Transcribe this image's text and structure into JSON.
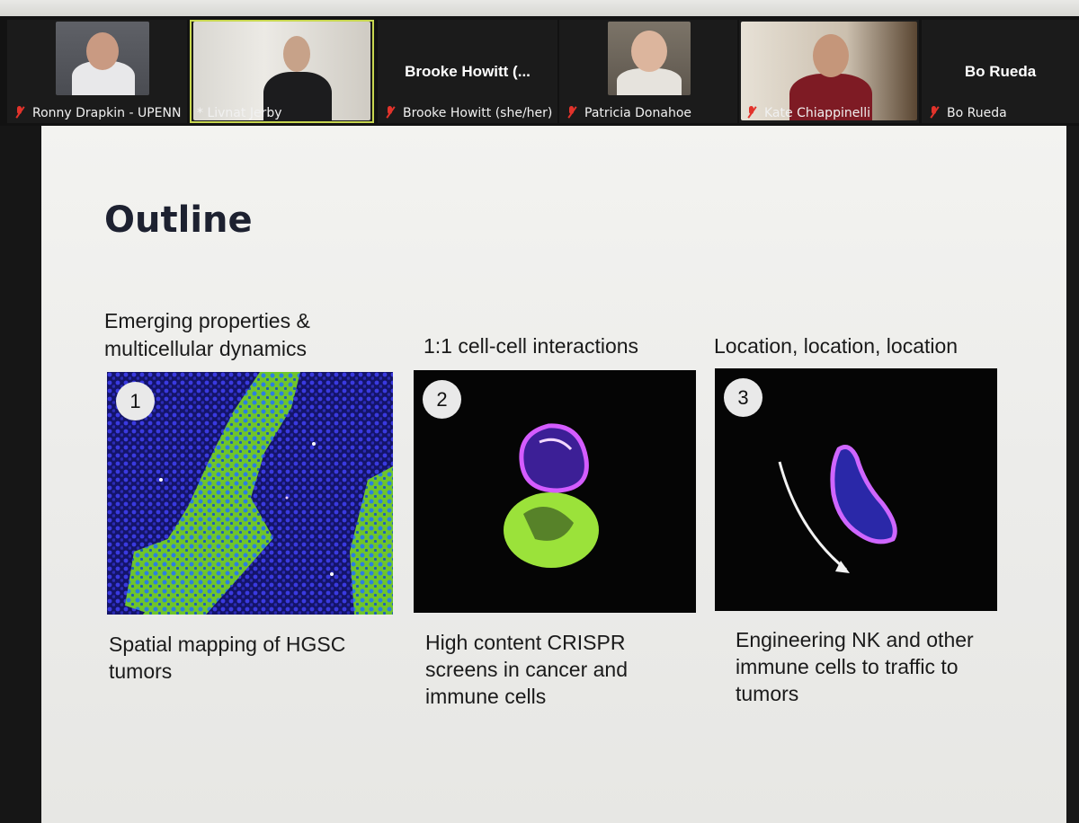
{
  "participants": [
    {
      "name": "Ronny Drapkin - UPENN",
      "muted": true,
      "video": true
    },
    {
      "name": "* Livnat Jerby",
      "muted": false,
      "video": true,
      "active_speaker": true
    },
    {
      "name": "Brooke Howitt (she/her)",
      "muted": true,
      "video": false,
      "display_name": "Brooke Howitt (..."
    },
    {
      "name": "Patricia Donahoe",
      "muted": true,
      "video": true
    },
    {
      "name": "Kate Chiappinelli",
      "muted": true,
      "video": true
    },
    {
      "name": "Bo Rueda",
      "muted": true,
      "video": false,
      "display_name": "Bo Rueda"
    }
  ],
  "slide": {
    "title": "Outline",
    "columns": [
      {
        "number": "1",
        "heading": "Emerging properties & multicellular dynamics",
        "caption": "Spatial mapping of HGSC tumors"
      },
      {
        "number": "2",
        "heading": "1:1 cell-cell interactions",
        "caption": "High content CRISPR screens in cancer and immune cells"
      },
      {
        "number": "3",
        "heading": "Location, location, location",
        "caption": "Engineering NK and other immune cells to traffic to tumors"
      }
    ]
  },
  "colors": {
    "muted_mic": "#e2332b",
    "active_speaker_border": "#c7d64f",
    "slide_title": "#1d2130",
    "nuclei_blue": "#2a2ab8",
    "tumor_green": "#7ed62e",
    "membrane_magenta": "#d24bff"
  }
}
